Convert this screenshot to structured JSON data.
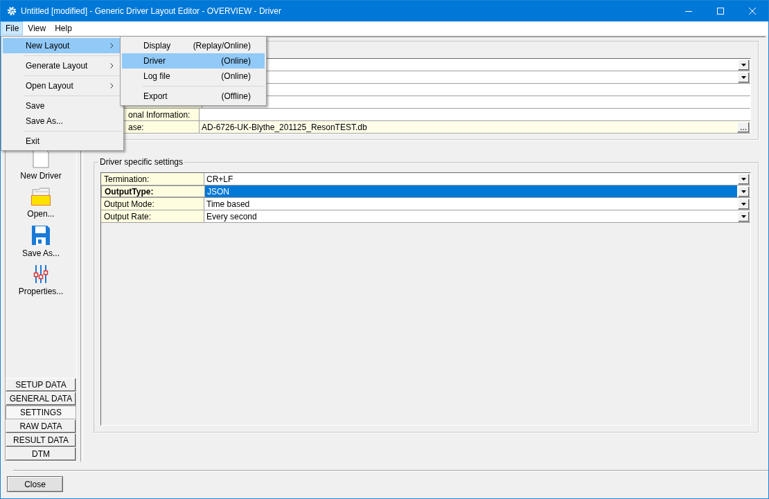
{
  "window": {
    "title": "Untitled [modified] - Generic Driver Layout Editor -  OVERVIEW - Driver"
  },
  "menu_bar": [
    {
      "label": "File",
      "selected": true
    },
    {
      "label": "View",
      "selected": false
    },
    {
      "label": "Help",
      "selected": false
    }
  ],
  "file_menu": [
    {
      "kind": "submenu",
      "label": "New Layout",
      "selected": true
    },
    {
      "kind": "separator"
    },
    {
      "kind": "submenu",
      "label": "Generate Layout",
      "selected": false
    },
    {
      "kind": "separator"
    },
    {
      "kind": "submenu",
      "label": "Open Layout",
      "selected": false
    },
    {
      "kind": "separator"
    },
    {
      "kind": "item",
      "label": "Save",
      "selected": false
    },
    {
      "kind": "item",
      "label": "Save As...",
      "selected": false
    },
    {
      "kind": "separator"
    },
    {
      "kind": "item",
      "label": "Exit",
      "selected": false
    }
  ],
  "new_layout_menu": [
    {
      "kind": "item",
      "label": "Display",
      "mode": "(Replay/Online)",
      "selected": false
    },
    {
      "kind": "item",
      "label": "Driver",
      "mode": "(Online)",
      "selected": true
    },
    {
      "kind": "item",
      "label": "Log file",
      "mode": "(Online)",
      "selected": false
    },
    {
      "kind": "separator"
    },
    {
      "kind": "item",
      "label": "Export",
      "mode": "(Offline)",
      "selected": false
    }
  ],
  "sidebar_tools": [
    {
      "kind": "new",
      "label": "New Driver"
    },
    {
      "kind": "open",
      "label": "Open..."
    },
    {
      "kind": "save",
      "label": "Save As..."
    },
    {
      "kind": "properties",
      "label": "Properties..."
    }
  ],
  "sidebar_tabs": [
    {
      "label": "SETUP DATA",
      "selected": false
    },
    {
      "label": "GENERAL DATA",
      "selected": false
    },
    {
      "label": "SETTINGS",
      "selected": true
    },
    {
      "label": "RAW DATA",
      "selected": false
    },
    {
      "label": "RESULT DATA",
      "selected": false
    },
    {
      "label": "DTM",
      "selected": false
    }
  ],
  "general_table": [
    {
      "kind": "dropdown"
    },
    {
      "kind": "dropdown"
    },
    {
      "kind": "text"
    },
    {
      "kind": "text"
    },
    {
      "kind": "text",
      "label": "onal Information:"
    },
    {
      "kind": "browse",
      "label": "ase:",
      "value": "AD-6726-UK-Blythe_201125_ResonTEST.db",
      "button": "..."
    }
  ],
  "driver_settings": {
    "title": "Driver specific settings",
    "rows": [
      {
        "label": "Termination:",
        "value": "CR+LF",
        "selected": false
      },
      {
        "label": "OutputType:",
        "value": "JSON",
        "selected": true
      },
      {
        "label": "Output Mode:",
        "value": "Time based",
        "selected": false
      },
      {
        "label": "Output Rate:",
        "value": "Every second",
        "selected": false
      }
    ]
  },
  "footer": {
    "close_button": "Close"
  }
}
